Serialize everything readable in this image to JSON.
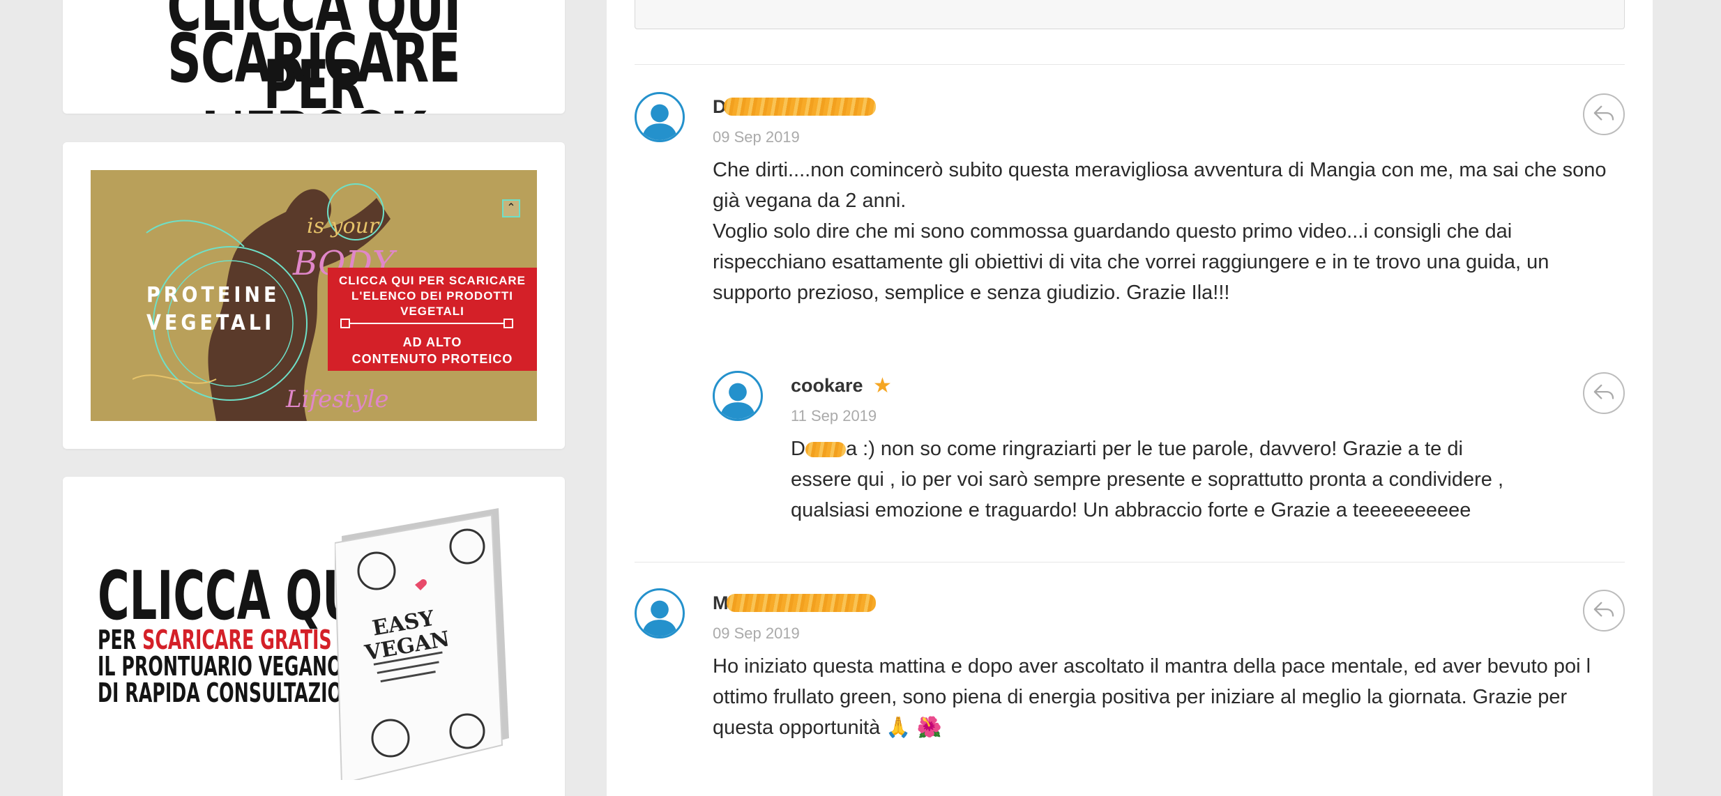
{
  "sidebar": {
    "ebook_widget": {
      "line1": "CLICCA QUI PER",
      "line2": "SCARICARE L'EBOOK"
    },
    "protein_banner": {
      "title": "PROTEINE\nVEGETALI",
      "cta_line1": "CLICCA QUI PER SCARICARE\nL'ELENCO DEI PRODOTTI\nVEGETALI",
      "cta_line2": "AD ALTO\nCONTENUTO PROTEICO",
      "scroll_up_icon": "⌃"
    },
    "vegan_cta": {
      "line1": "CLICCA QUI",
      "line2_prefix": "PER ",
      "line2_highlight": "SCARICARE GRATIS",
      "line3": "IL PRONTUARIO VEGANO",
      "line4": "DI RAPIDA CONSULTAZIONE",
      "book_title": "EASY\nVEGAN",
      "highlight_color": "#d42028"
    }
  },
  "comments": [
    {
      "author_visible": "D",
      "date": "09 Sep 2019",
      "text": "Che dirti....non comincerò subito questa meravigliosa avventura di Mangia con me, ma sai che sono già vegana da 2 anni.\nVoglio solo dire che mi sono commossa guardando questo primo video...i consigli che dai rispecchiano esattamente gli obiettivi di vita che vorrei raggiungere e in te trovo una guida, un supporto prezioso, semplice e senza giudizio. Grazie Ila!!!",
      "reply": {
        "author": "cookare",
        "star": "★",
        "date": "11 Sep 2019",
        "text_prefix": "D",
        "text": "a :) non so come ringraziarti per le tue parole, davvero! Grazie a te di essere qui , io per voi sarò sempre presente e soprattutto pronta a condividere , qualsiasi emozione e traguardo! Un abbraccio forte e Grazie a teeeeeeeeee"
      }
    },
    {
      "author_visible": "M",
      "date": "09 Sep 2019",
      "text": "Ho iniziato questa mattina e dopo aver ascoltato il mantra della pace mentale, ed aver bevuto poi l ottimo frullato green, sono piena di energia positiva per iniziare al meglio la giornata. Grazie per questa opportunità 🙏 🌺"
    }
  ],
  "colors": {
    "avatar_blue": "#2491cc",
    "star_orange": "#f5a623",
    "redaction_orange": "#f7a51c"
  }
}
